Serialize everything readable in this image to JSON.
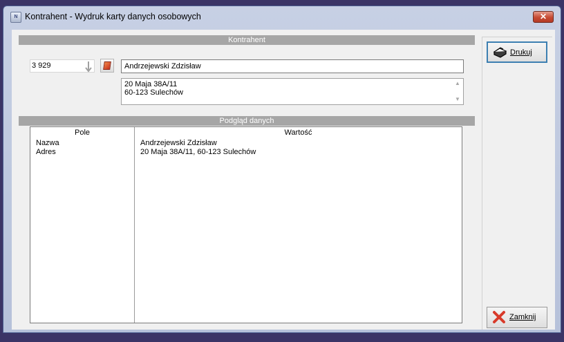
{
  "window": {
    "title": "Kontrahent - Wydruk karty danych osobowych",
    "icon": "app-icon",
    "close_label": "✕"
  },
  "contractor": {
    "section_title": "Kontrahent",
    "number": "3 929",
    "name": "Andrzejewski Zdzisław",
    "address_lines": [
      "20 Maja 38A/11",
      "60-123 Sulechów"
    ]
  },
  "preview": {
    "section_title": "Podgląd danych",
    "columns": [
      "Pole",
      "Wartość"
    ],
    "rows": [
      {
        "field": "Nazwa",
        "value": "Andrzejewski Zdzisław"
      },
      {
        "field": "Adres",
        "value": "20 Maja 38A/11, 60-123 Sulechów"
      }
    ]
  },
  "buttons": {
    "print_label": "Drukuj",
    "close_label": "Zamknij"
  },
  "colors": {
    "desktop": "#3b3466",
    "section_header": "#a6a6a6",
    "close_button": "#c64a32",
    "primary_focus": "#3c7fb1"
  }
}
